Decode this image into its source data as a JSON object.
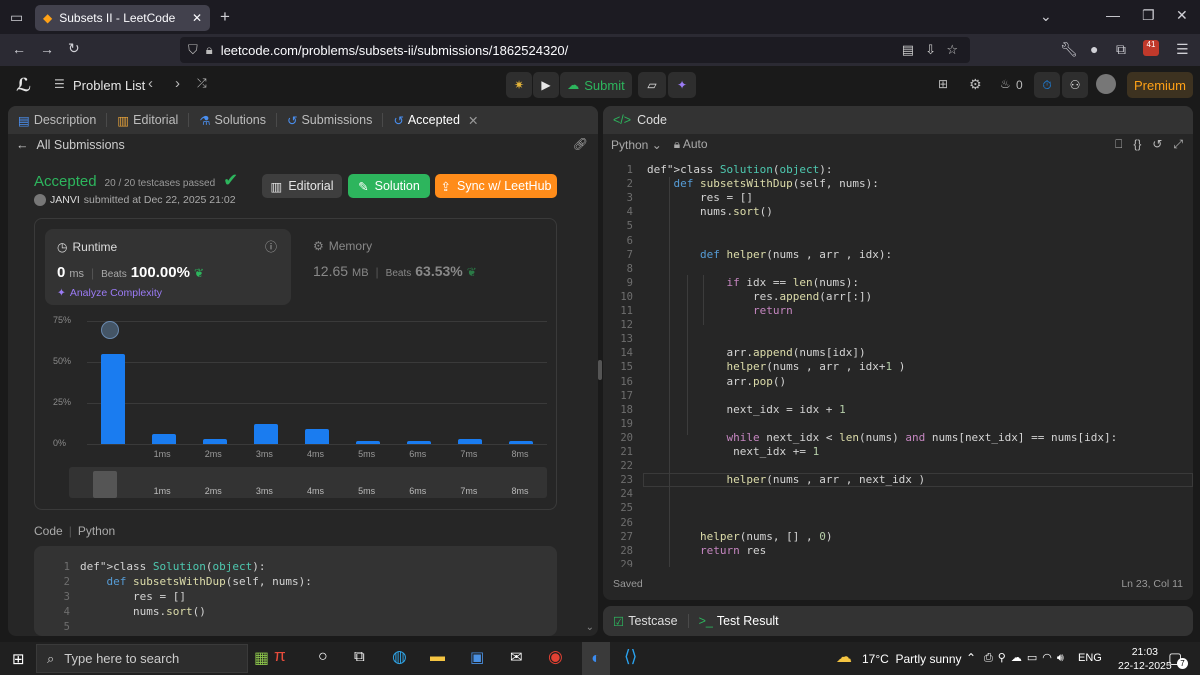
{
  "browser": {
    "tab_title": "Subsets II - LeetCode",
    "url": "leetcode.com/problems/subsets-ii/submissions/1862524320/",
    "badge_count": "41"
  },
  "nav": {
    "problem_list": "Problem List",
    "submit": "Submit",
    "streak": "0",
    "premium": "Premium"
  },
  "left_tabs": [
    "Description",
    "Editorial",
    "Solutions",
    "Submissions",
    "Accepted"
  ],
  "submission": {
    "back_label": "All Submissions",
    "status": "Accepted",
    "testcases": "20 / 20 testcases passed",
    "user": "JANVI",
    "submitted": "submitted at Dec 22, 2025 21:02",
    "editorial_btn": "Editorial",
    "solution_btn": "Solution",
    "sync_btn": "Sync w/ LeetHub",
    "runtime_label": "Runtime",
    "runtime_value": "0",
    "runtime_unit": "ms",
    "runtime_beats_label": "Beats",
    "runtime_beats": "100.00%",
    "analyze": "Analyze Complexity",
    "memory_label": "Memory",
    "memory_value": "12.65",
    "memory_unit": "MB",
    "memory_beats_label": "Beats",
    "memory_beats": "63.53%"
  },
  "chart_data": {
    "type": "bar",
    "y_ticks": [
      "75%",
      "50%",
      "25%",
      "0%"
    ],
    "ylim": [
      0,
      75
    ],
    "categories": [
      "",
      "1ms",
      "2ms",
      "3ms",
      "4ms",
      "5ms",
      "6ms",
      "7ms",
      "8ms"
    ],
    "values": [
      55,
      6,
      3,
      12,
      9,
      2,
      2,
      3,
      2
    ],
    "scroller_labels": [
      "1ms",
      "2ms",
      "3ms",
      "4ms",
      "5ms",
      "6ms",
      "7ms",
      "8ms"
    ]
  },
  "code_preview": {
    "label": "Code",
    "language": "Python",
    "lines": [
      {
        "n": "1",
        "text": "class Solution(object):"
      },
      {
        "n": "2",
        "text": "    def subsetsWithDup(self, nums):"
      },
      {
        "n": "3",
        "text": "        res = []"
      },
      {
        "n": "4",
        "text": "        nums.sort()"
      },
      {
        "n": "5",
        "text": ""
      }
    ]
  },
  "editor": {
    "title": "Code",
    "language": "Python",
    "mode": "Auto",
    "status": "Saved",
    "cursor": "Ln 23, Col 11",
    "lines": [
      {
        "n": "1",
        "text": "class Solution(object):"
      },
      {
        "n": "2",
        "text": "    def subsetsWithDup(self, nums):"
      },
      {
        "n": "3",
        "text": "        res = []"
      },
      {
        "n": "4",
        "text": "        nums.sort()"
      },
      {
        "n": "5",
        "text": ""
      },
      {
        "n": "6",
        "text": ""
      },
      {
        "n": "7",
        "text": "        def helper(nums , arr , idx):"
      },
      {
        "n": "8",
        "text": ""
      },
      {
        "n": "9",
        "text": "            if idx == len(nums):"
      },
      {
        "n": "10",
        "text": "                res.append(arr[:])"
      },
      {
        "n": "11",
        "text": "                return"
      },
      {
        "n": "12",
        "text": ""
      },
      {
        "n": "13",
        "text": ""
      },
      {
        "n": "14",
        "text": "            arr.append(nums[idx])"
      },
      {
        "n": "15",
        "text": "            helper(nums , arr , idx+1 )"
      },
      {
        "n": "16",
        "text": "            arr.pop()"
      },
      {
        "n": "17",
        "text": ""
      },
      {
        "n": "18",
        "text": "            next_idx = idx + 1"
      },
      {
        "n": "19",
        "text": ""
      },
      {
        "n": "20",
        "text": "            while next_idx < len(nums) and nums[next_idx] == nums[idx]:"
      },
      {
        "n": "21",
        "text": "             next_idx += 1"
      },
      {
        "n": "22",
        "text": ""
      },
      {
        "n": "23",
        "text": "            helper(nums , arr , next_idx )"
      },
      {
        "n": "24",
        "text": ""
      },
      {
        "n": "25",
        "text": ""
      },
      {
        "n": "26",
        "text": ""
      },
      {
        "n": "27",
        "text": "        helper(nums, [] , 0)"
      },
      {
        "n": "28",
        "text": "        return res"
      },
      {
        "n": "29",
        "text": ""
      }
    ]
  },
  "bottom_tabs": {
    "testcase": "Testcase",
    "result": "Test Result"
  },
  "taskbar": {
    "search_placeholder": "Type here to search",
    "weather": "17°C  Partly sunny",
    "lang": "ENG",
    "time": "21:03",
    "date": "22-12-2025",
    "notif": "7"
  },
  "colors": {
    "accent_green": "#2db55d",
    "accent_orange": "#ff8c1a",
    "bar_blue": "#1a7cf0",
    "premium": "#ffa116"
  }
}
